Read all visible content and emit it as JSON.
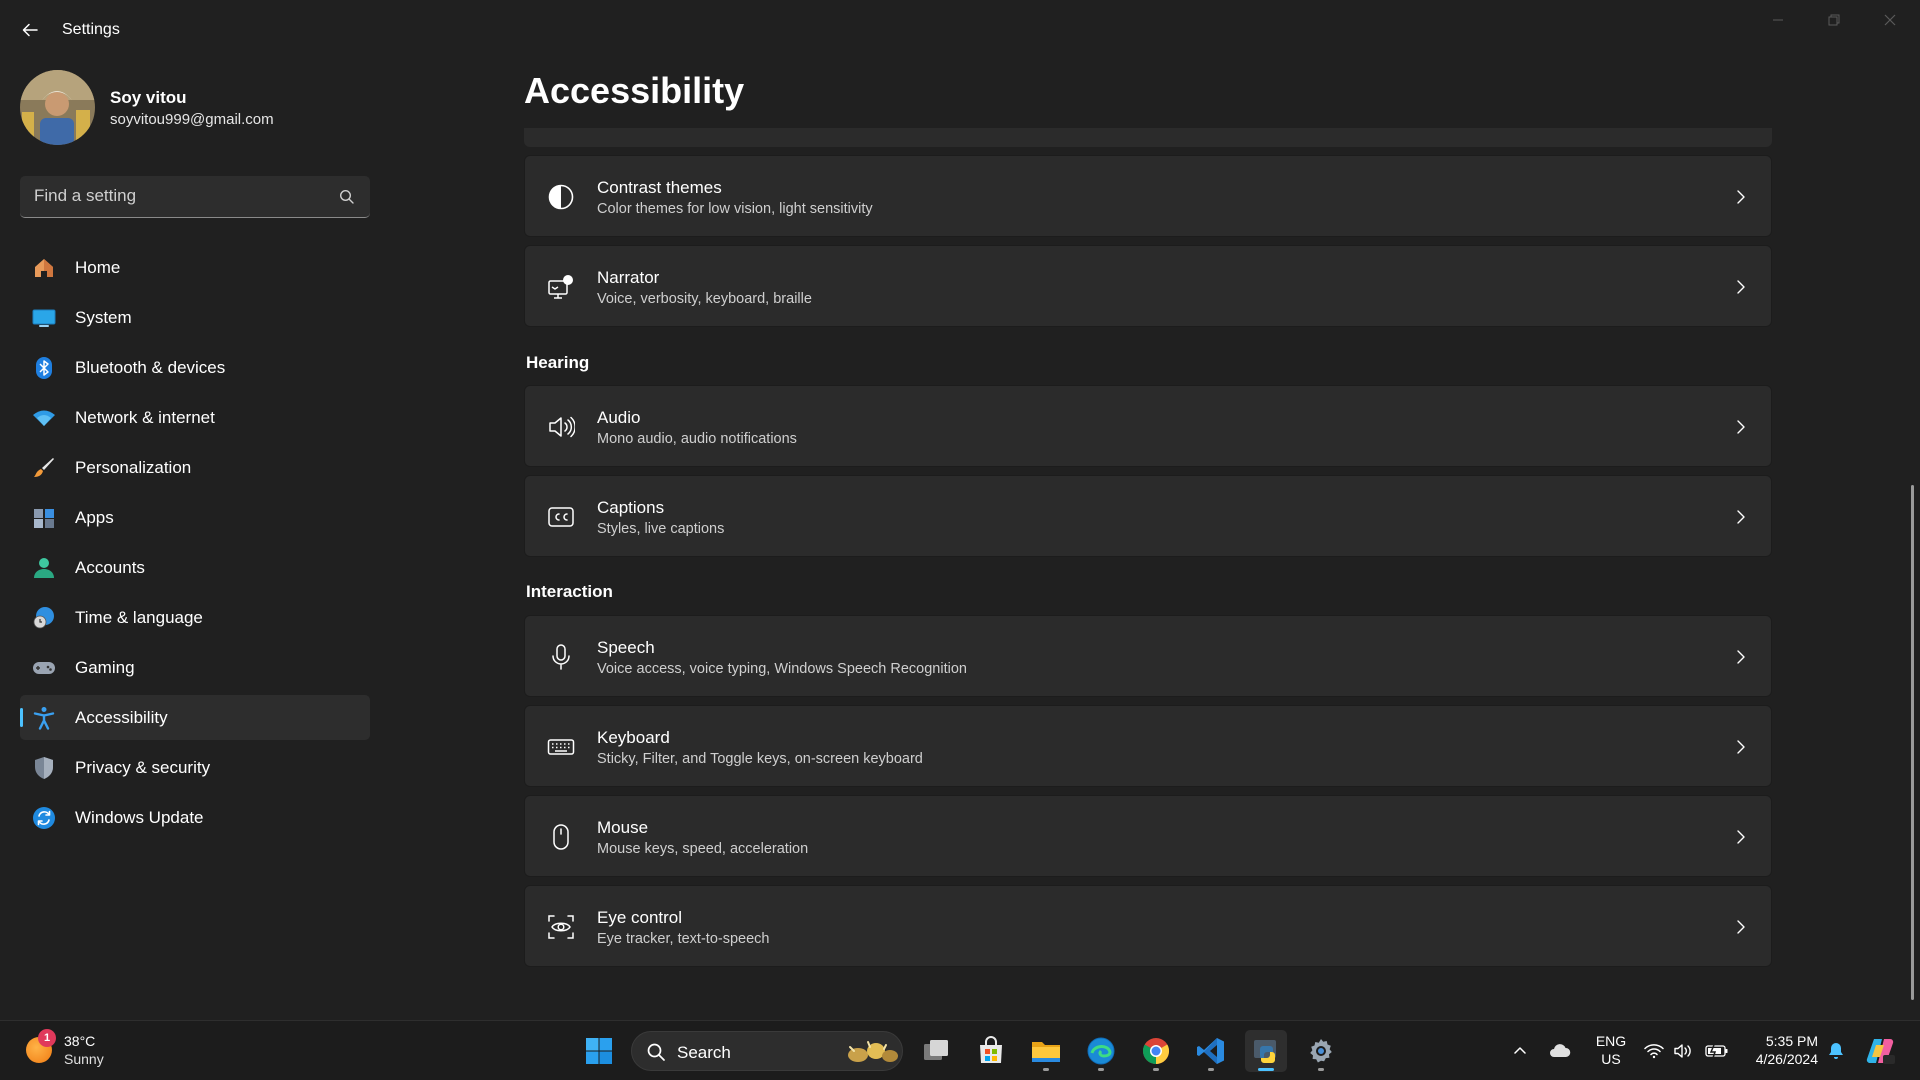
{
  "window": {
    "title": "Settings"
  },
  "profile": {
    "name": "Soy vitou",
    "email": "soyvitou999@gmail.com"
  },
  "search": {
    "placeholder": "Find a setting"
  },
  "sidebar": {
    "items": [
      {
        "label": "Home",
        "icon": "home-icon",
        "active": false
      },
      {
        "label": "System",
        "icon": "system-icon",
        "active": false
      },
      {
        "label": "Bluetooth & devices",
        "icon": "bluetooth-icon",
        "active": false
      },
      {
        "label": "Network & internet",
        "icon": "wifi-icon",
        "active": false
      },
      {
        "label": "Personalization",
        "icon": "brush-icon",
        "active": false
      },
      {
        "label": "Apps",
        "icon": "apps-icon",
        "active": false
      },
      {
        "label": "Accounts",
        "icon": "accounts-icon",
        "active": false
      },
      {
        "label": "Time & language",
        "icon": "time-language-icon",
        "active": false
      },
      {
        "label": "Gaming",
        "icon": "gamepad-icon",
        "active": false
      },
      {
        "label": "Accessibility",
        "icon": "accessibility-icon",
        "active": true
      },
      {
        "label": "Privacy & security",
        "icon": "shield-icon",
        "active": false
      },
      {
        "label": "Windows Update",
        "icon": "update-icon",
        "active": false
      }
    ]
  },
  "main": {
    "title": "Accessibility",
    "cards": {
      "contrast": {
        "title": "Contrast themes",
        "desc": "Color themes for low vision, light sensitivity"
      },
      "narrator": {
        "title": "Narrator",
        "desc": "Voice, verbosity, keyboard, braille"
      },
      "audio": {
        "title": "Audio",
        "desc": "Mono audio, audio notifications"
      },
      "captions": {
        "title": "Captions",
        "desc": "Styles, live captions"
      },
      "speech": {
        "title": "Speech",
        "desc": "Voice access, voice typing, Windows Speech Recognition"
      },
      "keyboard": {
        "title": "Keyboard",
        "desc": "Sticky, Filter, and Toggle keys, on-screen keyboard"
      },
      "mouse": {
        "title": "Mouse",
        "desc": "Mouse keys, speed, acceleration"
      },
      "eye": {
        "title": "Eye control",
        "desc": "Eye tracker, text-to-speech"
      }
    },
    "sections": {
      "hearing": "Hearing",
      "interaction": "Interaction"
    }
  },
  "taskbar": {
    "weather": {
      "badge": "1",
      "temp": "38°C",
      "condition": "Sunny"
    },
    "search_label": "Search",
    "lang": {
      "line1": "ENG",
      "line2": "US"
    },
    "clock": {
      "time": "5:35 PM",
      "date": "4/26/2024"
    }
  },
  "colors": {
    "accent": "#4cc2ff",
    "background": "#202020",
    "card": "#2b2b2b"
  }
}
